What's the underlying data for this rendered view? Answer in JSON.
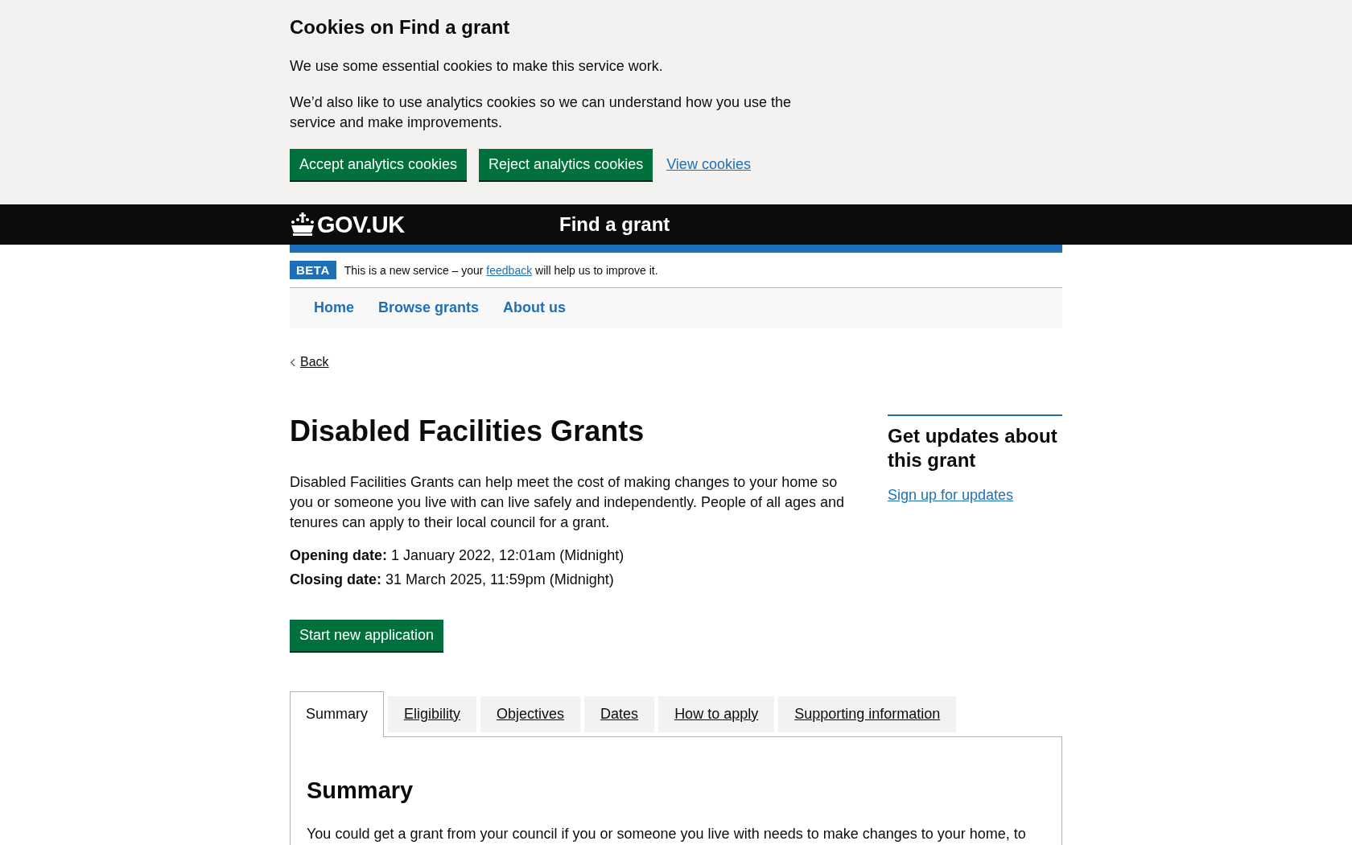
{
  "cookie_banner": {
    "title": "Cookies on Find a grant",
    "paragraphs": [
      "We use some essential cookies to make this service work.",
      "We’d also like to use analytics cookies so we can understand how you use the service and make improvements."
    ],
    "buttons": [
      "Accept analytics cookies",
      "Reject analytics cookies"
    ],
    "link": "View cookies"
  },
  "header": {
    "logo": "GOV.UK",
    "service_name": "Find a grant"
  },
  "phase_banner": {
    "tag": "BETA",
    "text_before": "This is a new service – your",
    "link": "feedback",
    "text_after": "will help us to improve it."
  },
  "nav": [
    {
      "label": "Home"
    },
    {
      "label": "Browse grants"
    },
    {
      "label": "About us"
    }
  ],
  "back_link": "Back",
  "title": "Disabled Facilities Grants",
  "description": "Disabled Facilities Grants can help meet the cost of making changes to your home so you or someone you live with can live safely and independently. People of all ages and tenures can apply to their local council for a grant.",
  "dates": [
    {
      "label": "Opening date:",
      "value": "1 January 2022, 12:01am (Midnight)"
    },
    {
      "label": "Closing date:",
      "value": "31 March 2025, 11:59pm (Midnight)"
    }
  ],
  "start_button": "Start new application",
  "sidebar": {
    "title": "Get updates about this grant",
    "link": "Sign up for updates"
  },
  "tabs": [
    {
      "label": "Summary",
      "selected": true
    },
    {
      "label": "Eligibility",
      "selected": false
    },
    {
      "label": "Objectives",
      "selected": false
    },
    {
      "label": "Dates",
      "selected": false
    },
    {
      "label": "How to apply",
      "selected": false
    },
    {
      "label": "Supporting information",
      "selected": false
    }
  ],
  "panel": {
    "title": "Summary",
    "text": "You could get a grant from your council if you or someone you live with needs to make changes to your home, to"
  }
}
